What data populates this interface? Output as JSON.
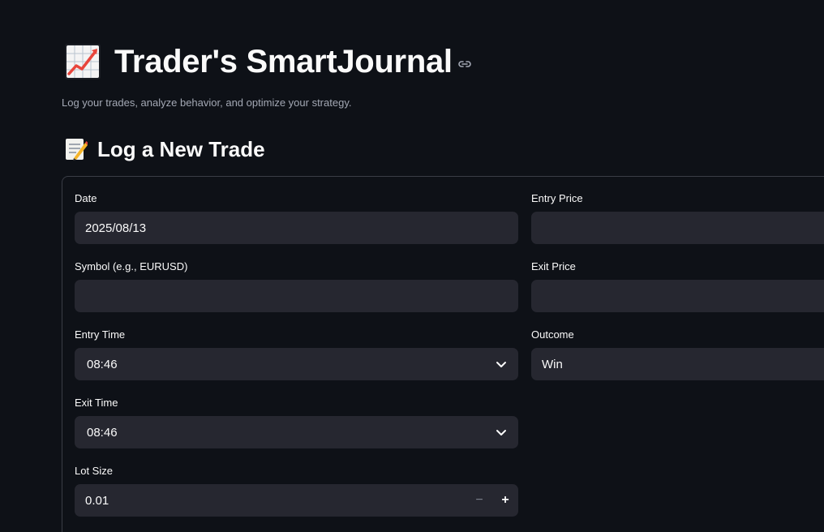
{
  "header": {
    "title_icon": "chart-increasing-icon",
    "title": "Trader's SmartJournal",
    "subtitle": "Log your trades, analyze behavior, and optimize your strategy."
  },
  "section": {
    "icon": "memo-icon",
    "title": "Log a New Trade"
  },
  "form": {
    "date": {
      "label": "Date",
      "value": "2025/08/13"
    },
    "symbol": {
      "label": "Symbol (e.g., EURUSD)",
      "value": ""
    },
    "entry_time": {
      "label": "Entry Time",
      "value": "08:46"
    },
    "exit_time": {
      "label": "Exit Time",
      "value": "08:46"
    },
    "lot_size": {
      "label": "Lot Size",
      "value": "0.01",
      "minus": "−",
      "plus": "+"
    },
    "entry_price": {
      "label": "Entry Price",
      "value": ""
    },
    "exit_price": {
      "label": "Exit Price",
      "value": ""
    },
    "outcome": {
      "label": "Outcome",
      "value": "Win"
    }
  },
  "colors": {
    "background": "#0e1117",
    "field": "#262730",
    "chart_up": "#e8453c"
  }
}
